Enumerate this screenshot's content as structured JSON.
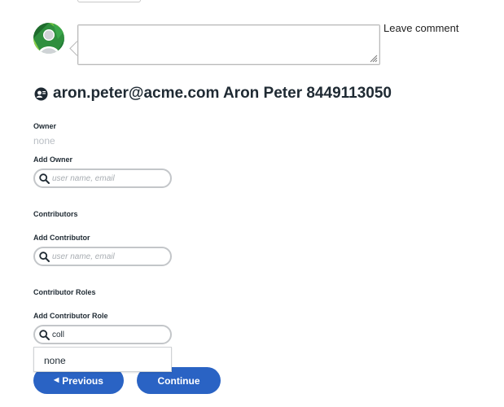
{
  "comment": {
    "textarea_value": "",
    "leave_comment_label": "Leave comment"
  },
  "user": {
    "email": "aron.peter@acme.com",
    "name": "Aron Peter",
    "phone": "8449113050",
    "title": "aron.peter@acme.com Aron Peter 8449113050"
  },
  "owner": {
    "label": "Owner",
    "value": "none"
  },
  "add_owner": {
    "label": "Add Owner",
    "placeholder": "user name, email",
    "value": ""
  },
  "contributors": {
    "label": "Contributors"
  },
  "add_contributor": {
    "label": "Add Contributor",
    "placeholder": "user name, email",
    "value": ""
  },
  "contributor_roles": {
    "label": "Contributor Roles"
  },
  "add_contributor_role": {
    "label": "Add Contributor Role",
    "value": "coll",
    "dropdown_options": [
      "none"
    ]
  },
  "buttons": {
    "previous": "Previous",
    "continue": "Continue"
  },
  "colors": {
    "primary_button": "#2a63c4",
    "muted_text": "#b9bec4",
    "field_border": "#c3c6c9"
  },
  "icons": {
    "avatar": "default-user-avatar",
    "title_icon": "user-badge-icon",
    "search": "search-icon",
    "previous": "chevron-left-icon"
  }
}
